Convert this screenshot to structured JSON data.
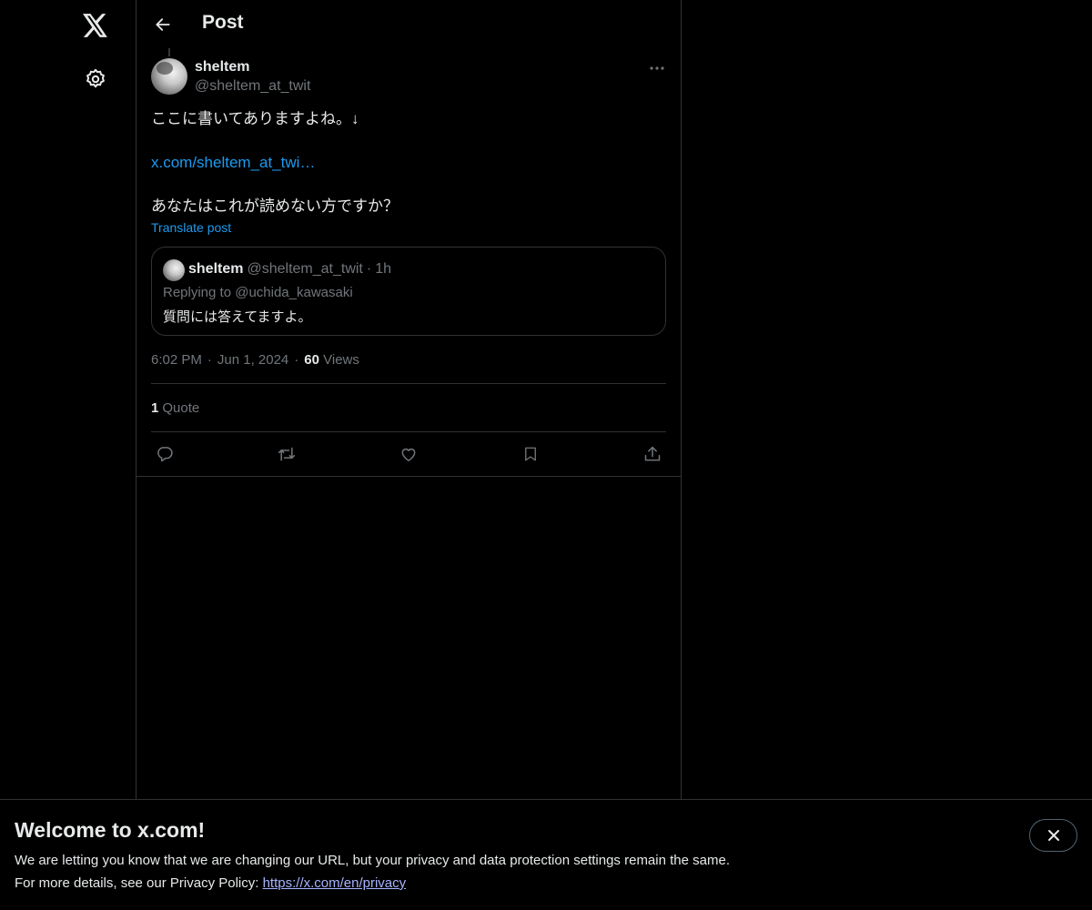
{
  "nav": {
    "logo_icon": "x-logo-icon",
    "settings_icon": "gear-icon"
  },
  "header": {
    "title": "Post",
    "back_icon": "back-arrow-icon"
  },
  "post": {
    "author_name": "sheltem",
    "author_handle": "@sheltem_at_twit",
    "text_line1": "ここに書いてありますよね。↓",
    "link_text": "x.com/sheltem_at_twi…",
    "text_line3": "あなたはこれが読めない方ですか？",
    "translate_label": "Translate post",
    "quoted": {
      "author_name": "sheltem",
      "author_handle": "@sheltem_at_twit",
      "separator": "·",
      "time": "1h",
      "replying_to": "Replying to @uchida_kawasaki",
      "text": "質問には答えてますよ。"
    },
    "time": "6:02 PM",
    "date": "Jun 1, 2024",
    "separator": "·",
    "views_count": "60",
    "views_label": "Views",
    "quotes_count": "1",
    "quotes_label": "Quote",
    "accent_color": "#1d9bf0"
  },
  "banner": {
    "title": "Welcome to x.com!",
    "line1": "We are letting you know that we are changing our URL, but your privacy and data protection settings remain the same.",
    "line2_prefix": "For more details, see our Privacy Policy: ",
    "privacy_link": "https://x.com/en/privacy"
  }
}
